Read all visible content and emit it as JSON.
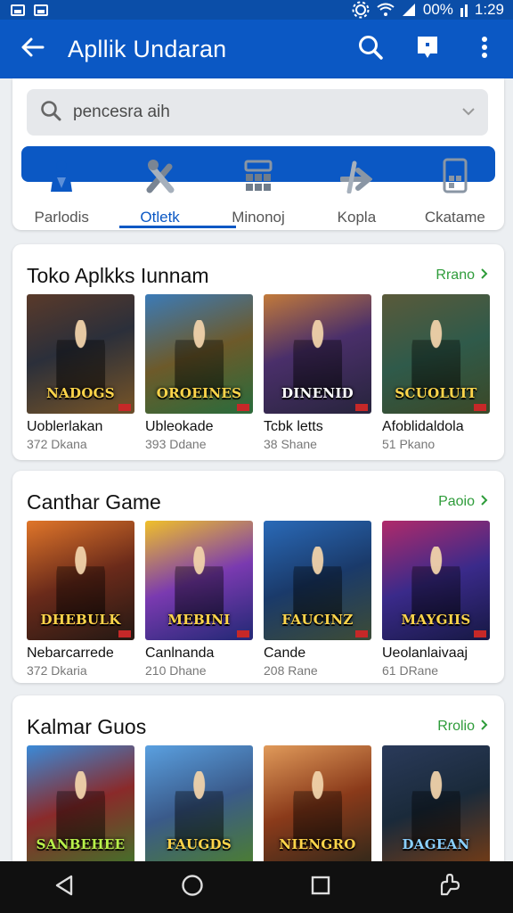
{
  "status_bar": {
    "battery_text": "00%",
    "time": "1:29"
  },
  "app_bar": {
    "title": "Apllik Undaran",
    "icons": [
      "back-arrow-icon",
      "search-icon",
      "message-icon",
      "more-vert-icon"
    ]
  },
  "search": {
    "placeholder": "pencesra aih"
  },
  "categories": [
    {
      "label": "Parlodis",
      "icon": "figure-icon",
      "active": false
    },
    {
      "label": "Otletk",
      "icon": "tools-icon",
      "active": true
    },
    {
      "label": "Minonoj",
      "icon": "grid-icon",
      "active": false
    },
    {
      "label": "Kopla",
      "icon": "arrow-icon",
      "active": false
    },
    {
      "label": "Ckatame",
      "icon": "phone-icon",
      "active": false
    }
  ],
  "sections": [
    {
      "title": "Toko Aplkks Iunnam",
      "more_label": "Rrano",
      "games": [
        {
          "name": "Uoblerlakan",
          "sub": "372 Dkana",
          "banner": "NADOGS"
        },
        {
          "name": "Ubleokade",
          "sub": "393 Ddane",
          "banner": "OROEINES"
        },
        {
          "name": "Tcbk letts",
          "sub": "38 Shane",
          "banner": "DINENID"
        },
        {
          "name": "Afoblidaldola",
          "sub": "51 Pkano",
          "banner": "SCUOLUIT"
        }
      ]
    },
    {
      "title": "Canthar Game",
      "more_label": "Paoio",
      "games": [
        {
          "name": "Nebarcarrede",
          "sub": "372 Dkaria",
          "banner": "DHEBULK"
        },
        {
          "name": "Canlnanda",
          "sub": "210 Dhane",
          "banner": "MEBINI"
        },
        {
          "name": "Cande",
          "sub": "208 Rane",
          "banner": "FAUCINZ"
        },
        {
          "name": "Ueolanlaivaaj",
          "sub": "61 DRane",
          "banner": "MAYGIIS"
        }
      ]
    },
    {
      "title": "Kalmar Guos",
      "more_label": "Rrolio",
      "games": [
        {
          "name": "",
          "sub": "",
          "banner": "SANBEHEE"
        },
        {
          "name": "",
          "sub": "",
          "banner": "FAUGDS"
        },
        {
          "name": "",
          "sub": "",
          "banner": "NIENGRO"
        },
        {
          "name": "",
          "sub": "",
          "banner": "DAGEAN"
        }
      ]
    }
  ],
  "colors": {
    "primary": "#0b58c4",
    "status": "#0b4ea8",
    "accent_green": "#2e9c3a",
    "nav": "#101010"
  }
}
